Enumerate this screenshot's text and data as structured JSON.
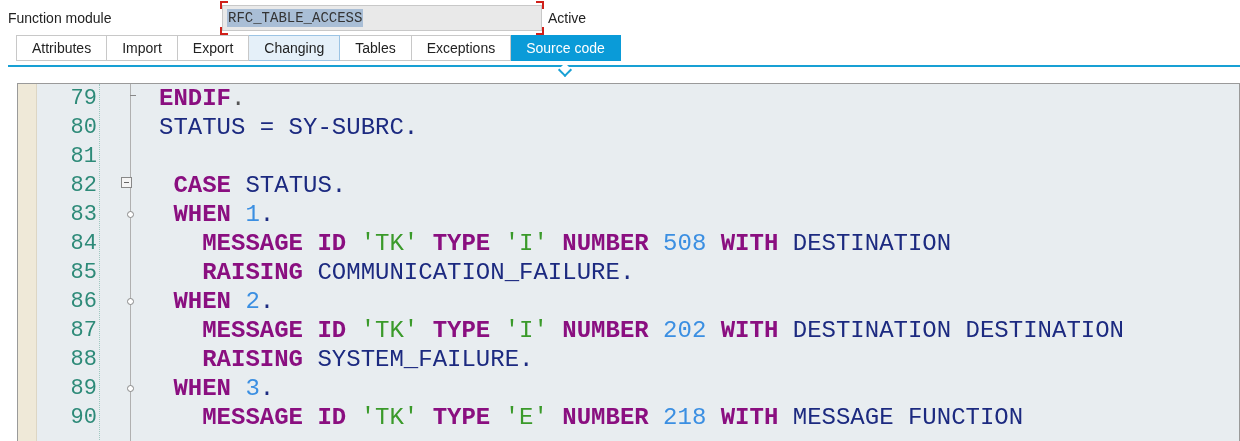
{
  "header": {
    "label": "Function module",
    "field_value": "RFC_TABLE_ACCESS",
    "value_selected": true,
    "status": "Active"
  },
  "tabs": [
    {
      "label": "Attributes",
      "selected": false,
      "hovered": false
    },
    {
      "label": "Import",
      "selected": false,
      "hovered": false
    },
    {
      "label": "Export",
      "selected": false,
      "hovered": false
    },
    {
      "label": "Changing",
      "selected": false,
      "hovered": true
    },
    {
      "label": "Tables",
      "selected": false,
      "hovered": false
    },
    {
      "label": "Exceptions",
      "selected": false,
      "hovered": false
    },
    {
      "label": "Source code",
      "selected": true,
      "hovered": false
    }
  ],
  "editor": {
    "lines": [
      {
        "number": "79",
        "kind": "end",
        "tokens": [
          {
            "kind": "keyword",
            "text": "ENDIF"
          },
          {
            "kind": "punct",
            "text": "."
          }
        ]
      },
      {
        "number": "80",
        "tokens": [
          {
            "kind": "ident",
            "text": "STATUS = SY-SUBRC."
          }
        ]
      },
      {
        "number": "81"
      },
      {
        "number": "82",
        "kind": "fold",
        "tokens": [
          {
            "kind": "keyword",
            "text": " CASE"
          },
          {
            "kind": "ident",
            "text": " STATUS."
          }
        ]
      },
      {
        "number": "83",
        "kind": "branch",
        "tokens": [
          {
            "kind": "keyword",
            "text": " WHEN"
          },
          {
            "kind": "number",
            "text": " 1"
          },
          {
            "kind": "ident",
            "text": "."
          }
        ]
      },
      {
        "number": "84",
        "tokens": [
          {
            "kind": "keyword",
            "text": "   MESSAGE ID"
          },
          {
            "kind": "string",
            "text": " 'TK'"
          },
          {
            "kind": "keyword",
            "text": " TYPE"
          },
          {
            "kind": "string",
            "text": " 'I'"
          },
          {
            "kind": "keyword",
            "text": " NUMBER"
          },
          {
            "kind": "number",
            "text": " 508"
          },
          {
            "kind": "keyword",
            "text": " WITH"
          },
          {
            "kind": "ident",
            "text": " DESTINATION"
          }
        ]
      },
      {
        "number": "85",
        "tokens": [
          {
            "kind": "keyword",
            "text": "   RAISING"
          },
          {
            "kind": "ident",
            "text": " COMMUNICATION_FAILURE."
          }
        ]
      },
      {
        "number": "86",
        "kind": "branch",
        "tokens": [
          {
            "kind": "keyword",
            "text": " WHEN"
          },
          {
            "kind": "number",
            "text": " 2"
          },
          {
            "kind": "ident",
            "text": "."
          }
        ]
      },
      {
        "number": "87",
        "tokens": [
          {
            "kind": "keyword",
            "text": "   MESSAGE ID"
          },
          {
            "kind": "string",
            "text": " 'TK'"
          },
          {
            "kind": "keyword",
            "text": " TYPE"
          },
          {
            "kind": "string",
            "text": " 'I'"
          },
          {
            "kind": "keyword",
            "text": " NUMBER"
          },
          {
            "kind": "number",
            "text": " 202"
          },
          {
            "kind": "keyword",
            "text": " WITH"
          },
          {
            "kind": "ident",
            "text": " DESTINATION DESTINATION"
          }
        ]
      },
      {
        "number": "88",
        "tokens": [
          {
            "kind": "keyword",
            "text": "   RAISING"
          },
          {
            "kind": "ident",
            "text": " SYSTEM_FAILURE."
          }
        ]
      },
      {
        "number": "89",
        "kind": "branch",
        "tokens": [
          {
            "kind": "keyword",
            "text": " WHEN"
          },
          {
            "kind": "number",
            "text": " 3"
          },
          {
            "kind": "ident",
            "text": "."
          }
        ]
      },
      {
        "number": "90",
        "tokens": [
          {
            "kind": "keyword",
            "text": "   MESSAGE ID"
          },
          {
            "kind": "string",
            "text": " 'TK'"
          },
          {
            "kind": "keyword",
            "text": " TYPE"
          },
          {
            "kind": "string",
            "text": " 'E'"
          },
          {
            "kind": "keyword",
            "text": " NUMBER"
          },
          {
            "kind": "number",
            "text": " 218"
          },
          {
            "kind": "keyword",
            "text": " WITH"
          },
          {
            "kind": "ident",
            "text": " MESSAGE FUNCTION"
          }
        ]
      }
    ]
  }
}
